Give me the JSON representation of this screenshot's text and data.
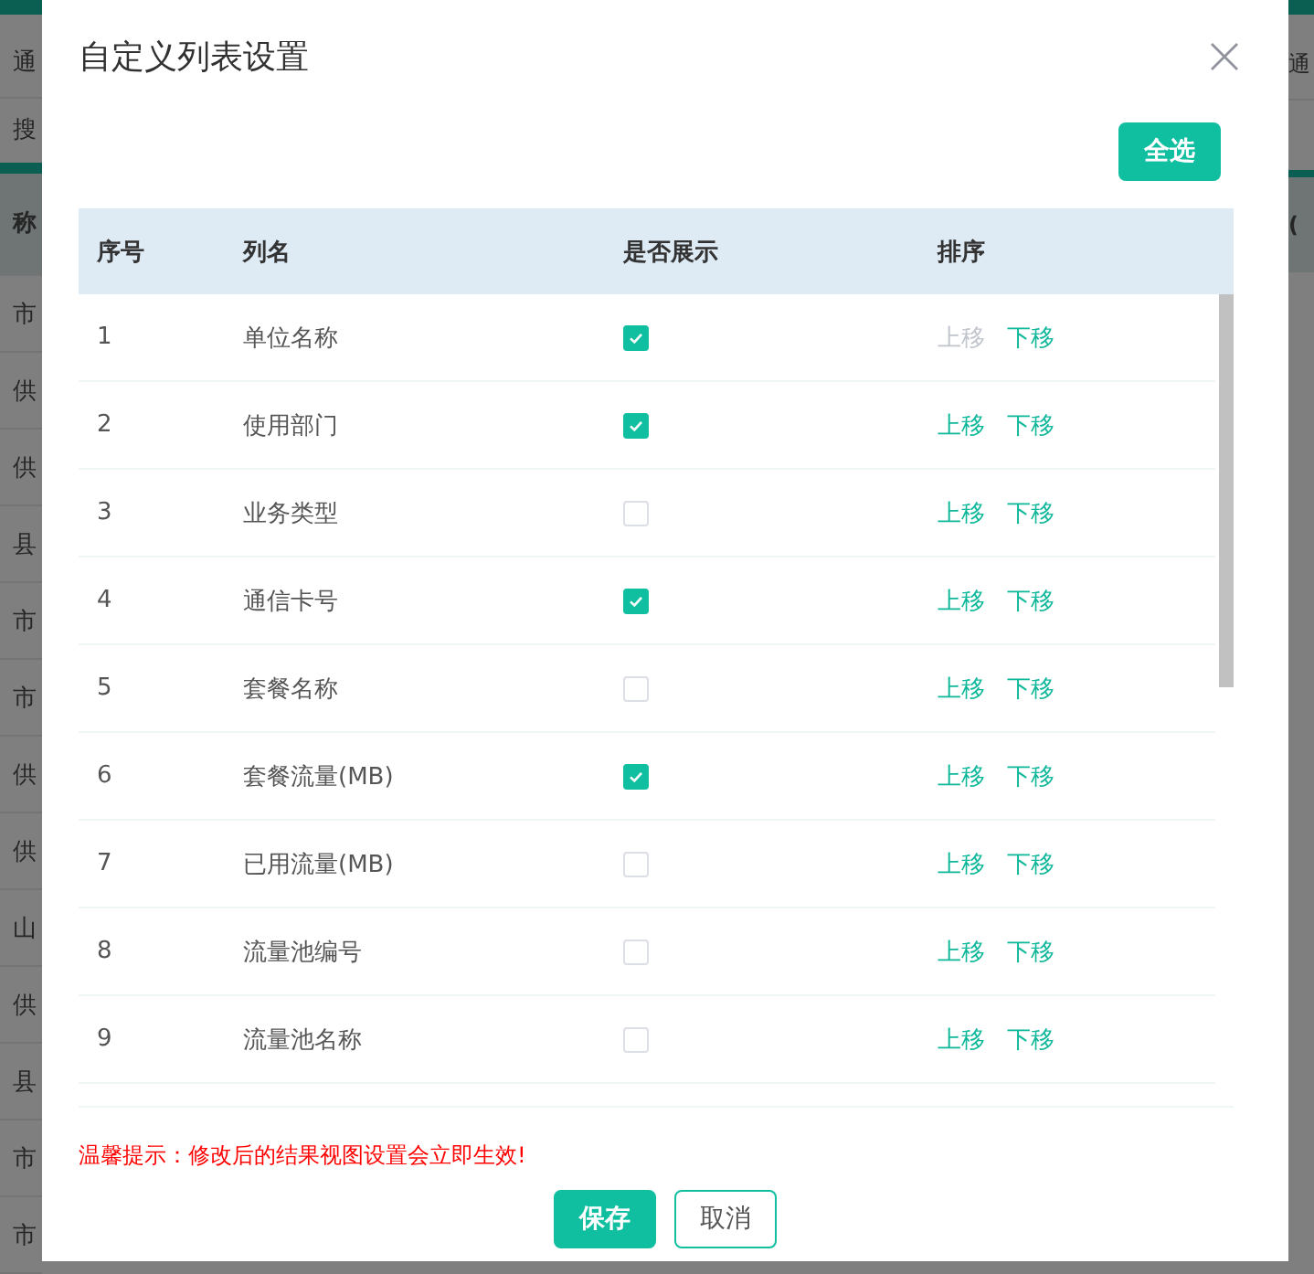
{
  "background": {
    "left_texts": [
      "通",
      "搜",
      "称",
      "市",
      "供",
      "供",
      "县",
      "市",
      "市",
      "供",
      "供",
      "山",
      "供",
      "县",
      "市",
      "市"
    ],
    "right_texts": [
      "通",
      "("
    ]
  },
  "dialog": {
    "title": "自定义列表设置",
    "select_all_button": "全选",
    "table": {
      "columns": [
        "序号",
        "列名",
        "是否展示",
        "排序"
      ],
      "rows": [
        {
          "index": "1",
          "name": "单位名称",
          "checked": true,
          "up": {
            "label": "上移",
            "disabled": true
          },
          "down": {
            "label": "下移",
            "disabled": false
          }
        },
        {
          "index": "2",
          "name": "使用部门",
          "checked": true,
          "up": {
            "label": "上移",
            "disabled": false
          },
          "down": {
            "label": "下移",
            "disabled": false
          }
        },
        {
          "index": "3",
          "name": "业务类型",
          "checked": false,
          "up": {
            "label": "上移",
            "disabled": false
          },
          "down": {
            "label": "下移",
            "disabled": false
          }
        },
        {
          "index": "4",
          "name": "通信卡号",
          "checked": true,
          "up": {
            "label": "上移",
            "disabled": false
          },
          "down": {
            "label": "下移",
            "disabled": false
          }
        },
        {
          "index": "5",
          "name": "套餐名称",
          "checked": false,
          "up": {
            "label": "上移",
            "disabled": false
          },
          "down": {
            "label": "下移",
            "disabled": false
          }
        },
        {
          "index": "6",
          "name": "套餐流量(MB)",
          "checked": true,
          "up": {
            "label": "上移",
            "disabled": false
          },
          "down": {
            "label": "下移",
            "disabled": false
          }
        },
        {
          "index": "7",
          "name": "已用流量(MB)",
          "checked": false,
          "up": {
            "label": "上移",
            "disabled": false
          },
          "down": {
            "label": "下移",
            "disabled": false
          }
        },
        {
          "index": "8",
          "name": "流量池编号",
          "checked": false,
          "up": {
            "label": "上移",
            "disabled": false
          },
          "down": {
            "label": "下移",
            "disabled": false
          }
        },
        {
          "index": "9",
          "name": "流量池名称",
          "checked": false,
          "up": {
            "label": "上移",
            "disabled": false
          },
          "down": {
            "label": "下移",
            "disabled": false
          }
        }
      ]
    },
    "tip": "温馨提示：修改后的结果视图设置会立即生效!",
    "buttons": [
      {
        "label": "保存",
        "kind": "primary"
      },
      {
        "label": "取消",
        "kind": "secondary"
      }
    ]
  }
}
